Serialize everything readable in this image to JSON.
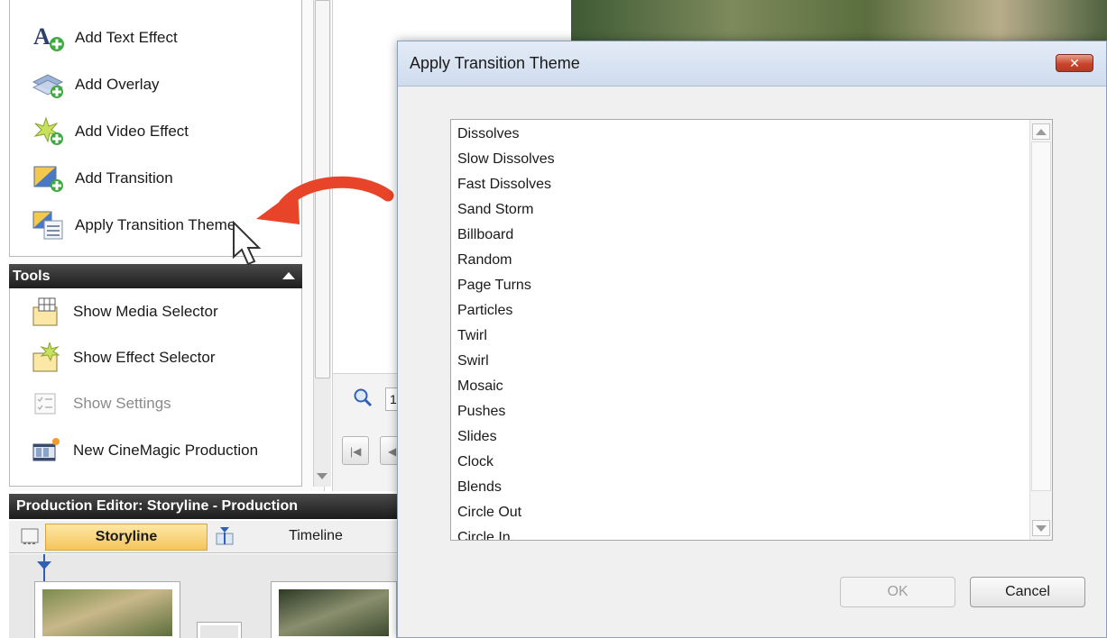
{
  "tasks": {
    "items": [
      {
        "label": "Add Text Effect",
        "icon": "text-effect-icon"
      },
      {
        "label": "Add Overlay",
        "icon": "overlay-icon"
      },
      {
        "label": "Add Video Effect",
        "icon": "video-effect-icon"
      },
      {
        "label": "Add Transition",
        "icon": "transition-icon"
      },
      {
        "label": "Apply Transition Theme",
        "icon": "transition-theme-icon"
      }
    ]
  },
  "tools": {
    "header": "Tools",
    "items": [
      {
        "label": "Show Media Selector",
        "icon": "media-selector-icon"
      },
      {
        "label": "Show Effect Selector",
        "icon": "effect-selector-icon"
      },
      {
        "label": "Show Settings",
        "icon": "settings-icon",
        "disabled": true
      },
      {
        "label": "New CineMagic Production",
        "icon": "cinemagic-icon"
      }
    ]
  },
  "zoom": {
    "value": "1"
  },
  "production_editor": {
    "title": "Production Editor: Storyline - Production",
    "tabs": [
      {
        "label": "Storyline",
        "active": true
      },
      {
        "label": "Timeline",
        "active": false
      }
    ]
  },
  "dialog": {
    "title": "Apply Transition Theme",
    "close_label": "✕",
    "themes": [
      "Dissolves",
      "Slow Dissolves",
      "Fast Dissolves",
      "Sand Storm",
      "Billboard",
      "Random",
      "Page Turns",
      "Particles",
      "Twirl",
      "Swirl",
      "Mosaic",
      "Pushes",
      "Slides",
      "Clock",
      "Blends",
      "Circle Out",
      "Circle In"
    ],
    "ok_label": "OK",
    "cancel_label": "Cancel"
  },
  "colors": {
    "accent_arrow": "#e8442a",
    "tab_active": "#f6c55c",
    "close_button": "#c8452b"
  }
}
